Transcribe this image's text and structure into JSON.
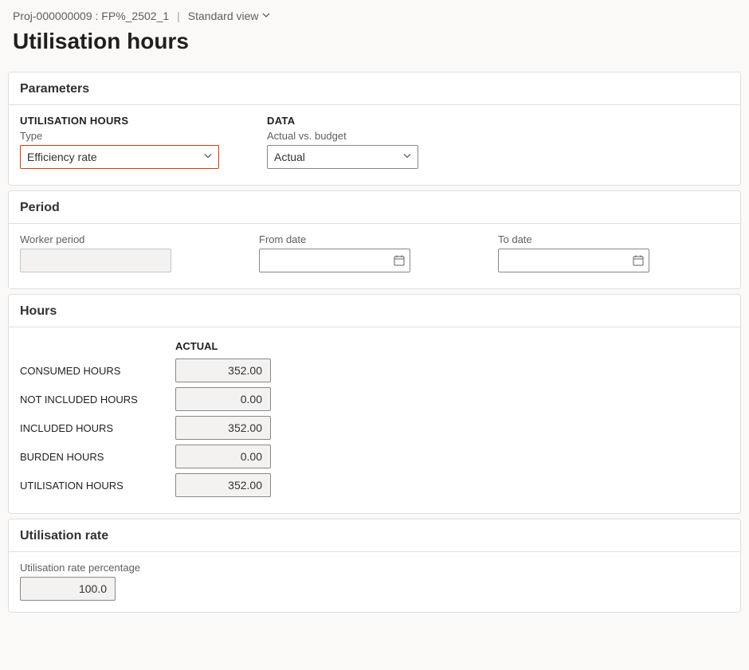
{
  "breadcrumb": {
    "project": "Proj-000000009 : FP%_2502_1",
    "view_label": "Standard view"
  },
  "page_title": "Utilisation hours",
  "parameters": {
    "header": "Parameters",
    "utilisation_hours": {
      "heading": "UTILISATION HOURS",
      "type_label": "Type",
      "type_value": "Efficiency rate"
    },
    "data": {
      "heading": "DATA",
      "avb_label": "Actual vs. budget",
      "avb_value": "Actual"
    }
  },
  "period": {
    "header": "Period",
    "worker_label": "Worker period",
    "worker_value": "",
    "from_label": "From date",
    "from_value": "",
    "to_label": "To date",
    "to_value": ""
  },
  "hours": {
    "header": "Hours",
    "col_actual": "ACTUAL",
    "rows": [
      {
        "label": "CONSUMED HOURS",
        "actual": "352.00"
      },
      {
        "label": "NOT INCLUDED HOURS",
        "actual": "0.00"
      },
      {
        "label": "INCLUDED HOURS",
        "actual": "352.00"
      },
      {
        "label": "BURDEN HOURS",
        "actual": "0.00"
      },
      {
        "label": "UTILISATION HOURS",
        "actual": "352.00"
      }
    ]
  },
  "rate": {
    "header": "Utilisation rate",
    "percent_label": "Utilisation rate percentage",
    "percent_value": "100.0"
  }
}
